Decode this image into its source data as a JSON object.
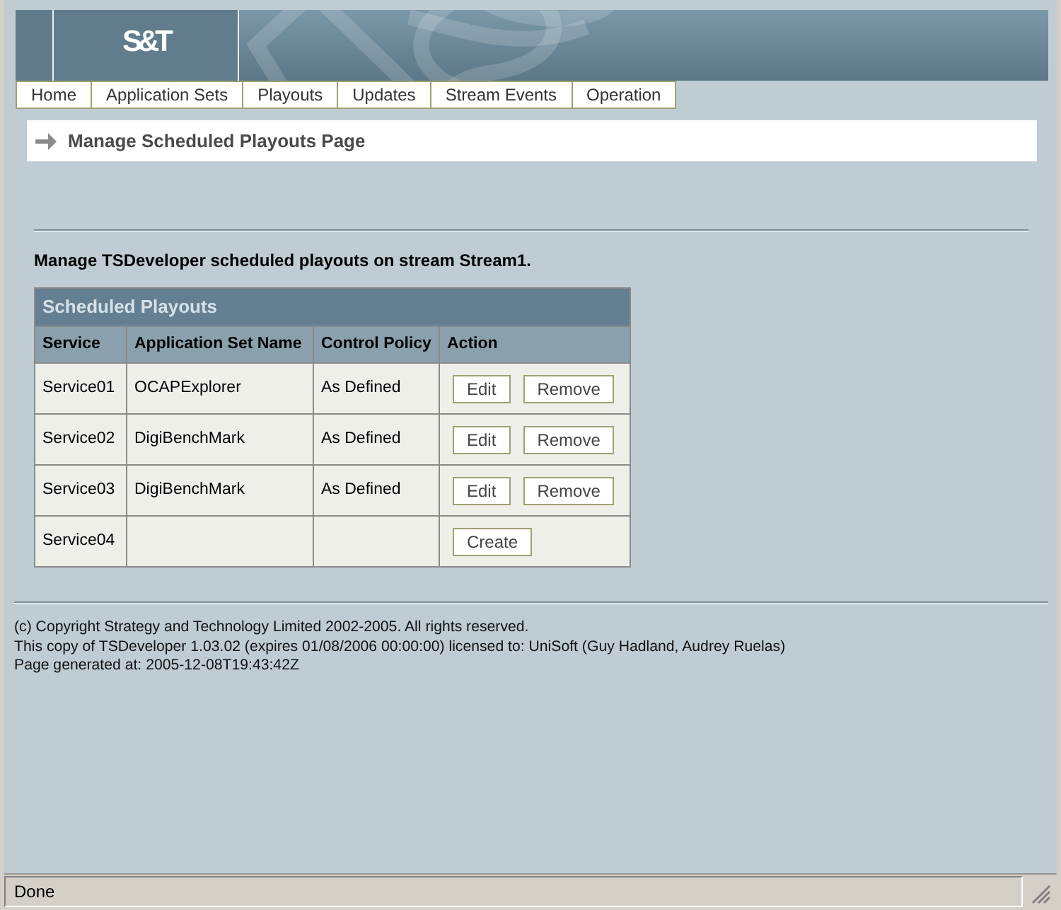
{
  "header": {
    "logo": "S&T"
  },
  "nav": [
    "Home",
    "Application Sets",
    "Playouts",
    "Updates",
    "Stream Events",
    "Operation"
  ],
  "page_title": "Manage Scheduled Playouts Page",
  "intro": "Manage TSDeveloper scheduled playouts on stream Stream1.",
  "table": {
    "title": "Scheduled Playouts",
    "columns": [
      "Service",
      "Application Set Name",
      "Control Policy",
      "Action"
    ],
    "rows": [
      {
        "service": "Service01",
        "application_set_name": "OCAPExplorer",
        "control_policy": "As Defined",
        "actions": [
          "Edit",
          "Remove"
        ]
      },
      {
        "service": "Service02",
        "application_set_name": "DigiBenchMark",
        "control_policy": "As Defined",
        "actions": [
          "Edit",
          "Remove"
        ]
      },
      {
        "service": "Service03",
        "application_set_name": "DigiBenchMark",
        "control_policy": "As Defined",
        "actions": [
          "Edit",
          "Remove"
        ]
      },
      {
        "service": "Service04",
        "actions": [
          "Create"
        ]
      }
    ]
  },
  "footer": [
    "(c) Copyright Strategy and Technology Limited 2002-2005. All rights reserved.",
    "This copy of TSDeveloper 1.03.02 (expires 01/08/2006 00:00:00) licensed to: UniSoft (Guy Hadland, Audrey Ruelas)",
    "Page generated at: 2005-12-08T19:43:42Z"
  ],
  "status_bar": {
    "text": "Done"
  }
}
